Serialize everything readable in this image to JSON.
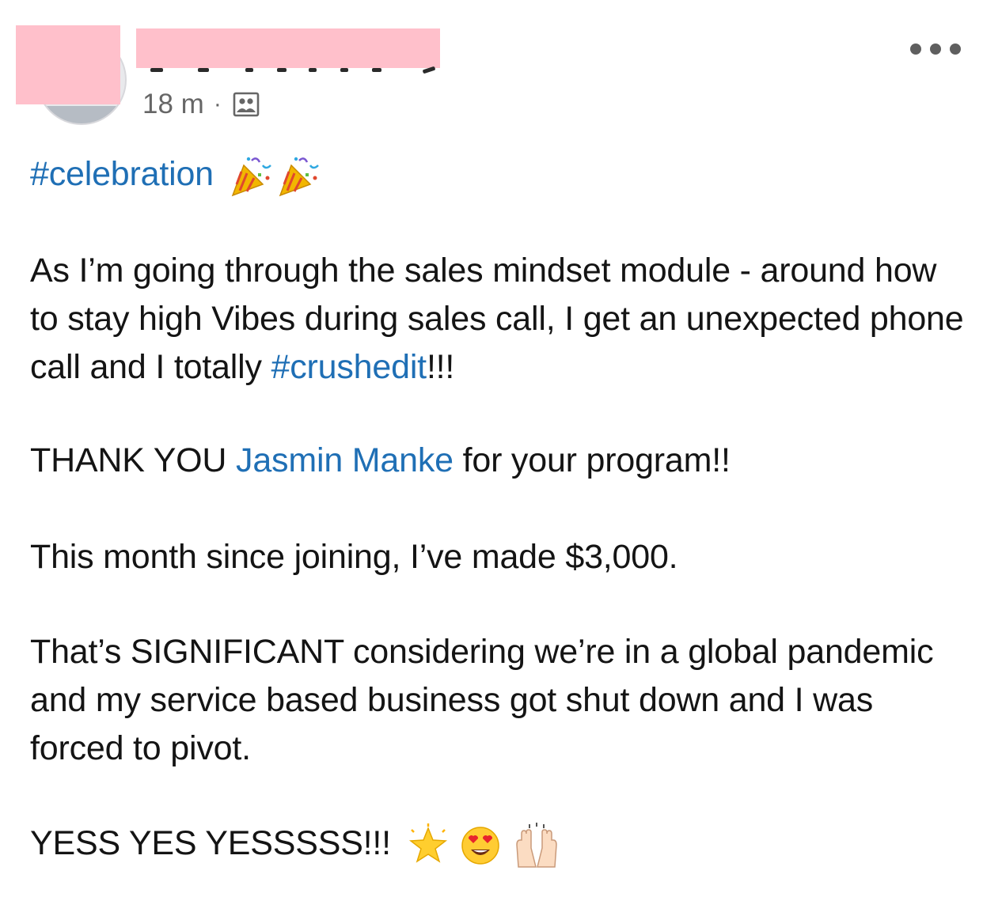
{
  "post": {
    "timestamp": "18 m",
    "separator": "·",
    "audience_icon": "group-icon",
    "more_icon": "more-horizontal-icon",
    "hashtag": "#celebration",
    "hashtag_emoji": "party-popper-icon",
    "paragraph_1_text": "As I’m going through the sales mindset module - around how to stay high Vibes during sales call, I get an unexpected phone call and I totally ",
    "paragraph_1_link": "#crushedit",
    "paragraph_1_end": "!!!",
    "paragraph_2_start": "THANK YOU ",
    "paragraph_2_mention": "Jasmin Manke",
    "paragraph_2_end": " for your program!!",
    "paragraph_3": "This month since joining, I’ve made $3,000.",
    "paragraph_4": "That’s SIGNIFICANT considering we’re in a global pandemic and my service based business got shut down and I was forced to pivot.",
    "paragraph_5": "YESS YES YESSSSS!!!",
    "closing_emojis": [
      "glowing-star-icon",
      "heart-eyes-face-icon",
      "raising-hands-icon"
    ]
  },
  "colors": {
    "link": "#1f6fb5",
    "text": "#141414",
    "meta": "#666666",
    "redaction": "#ffc0cb"
  }
}
